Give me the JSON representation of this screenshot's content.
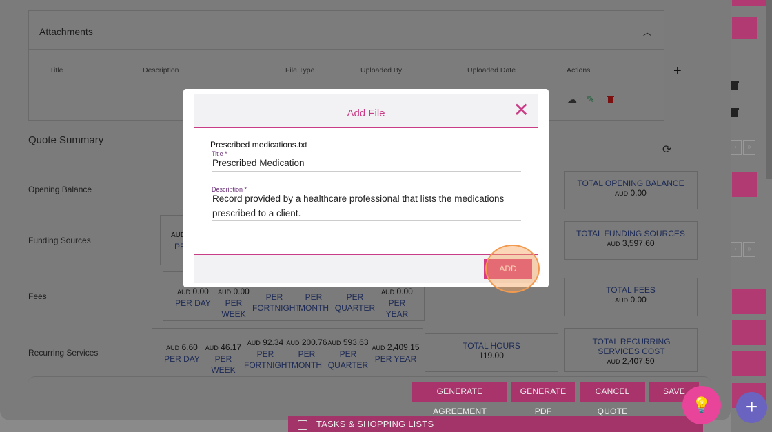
{
  "attachments": {
    "title": "Attachments",
    "headers": [
      "Title",
      "Description",
      "File Type",
      "Uploaded By",
      "Uploaded Date",
      "Actions"
    ]
  },
  "quote_summary": {
    "title": "Quote Summary",
    "rows": {
      "opening_balance": "Opening Balance",
      "funding_sources": "Funding Sources",
      "fees": "Fees",
      "recurring_services": "Recurring Services"
    },
    "funding_partial": {
      "cur": "AUD",
      "per": "PE"
    },
    "fees_cells": [
      {
        "cur": "AUD",
        "amount": "0.00",
        "period": "PER DAY"
      },
      {
        "cur": "AUD",
        "amount": "0.00",
        "period": "PER WEEK"
      },
      {
        "period": "PER FORTNIGHT"
      },
      {
        "period": "PER MONTH"
      },
      {
        "period": "PER QUARTER"
      },
      {
        "cur": "AUD",
        "amount": "0.00",
        "period": "PER YEAR"
      }
    ],
    "recurring_cells": [
      {
        "cur": "AUD",
        "amount": "6.60",
        "period": "PER DAY"
      },
      {
        "cur": "AUD",
        "amount": "46.17",
        "period": "PER WEEK"
      },
      {
        "cur": "AUD",
        "amount": "92.34",
        "period": "PER FORTNIGHT"
      },
      {
        "cur": "AUD",
        "amount": "200.76",
        "period": "PER MONTH"
      },
      {
        "cur": "AUD",
        "amount": "593.63",
        "period": "PER QUARTER"
      },
      {
        "cur": "AUD",
        "amount": "2,409.15",
        "period": "PER YEAR"
      }
    ],
    "totals": {
      "opening": {
        "label": "TOTAL OPENING BALANCE",
        "cur": "AUD",
        "value": "0.00"
      },
      "funding": {
        "label": "TOTAL FUNDING SOURCES",
        "cur": "AUD",
        "value": "3,597.60"
      },
      "fees": {
        "label": "TOTAL FEES",
        "cur": "AUD",
        "value": "0.00"
      },
      "recurring": {
        "label": "TOTAL RECURRING SERVICES COST",
        "cur": "AUD",
        "value": "2,407.50"
      },
      "hours": {
        "label": "TOTAL HOURS",
        "value": "119.00"
      }
    }
  },
  "actions": {
    "generate_agreement": "GENERATE AGREEMENT",
    "generate_pdf": "GENERATE PDF",
    "cancel_quote": "CANCEL QUOTE",
    "save": "SAVE"
  },
  "bottom_bar": {
    "label": "TASKS & SHOPPING LISTS"
  },
  "modal": {
    "title": "Add File",
    "file_name": "Prescribed medications.txt",
    "title_label": "Title *",
    "title_value": "Prescribed Medication",
    "description_label": "Description *",
    "description_value_line1": "Record provided by a healthcare professional that lists the medications",
    "description_value_line2": "prescribed to a client.",
    "add_button": "ADD"
  },
  "icons": {
    "close": "close-icon",
    "upload": "cloud-upload-icon",
    "edit": "pencil-icon",
    "delete": "trash-icon",
    "refresh": "refresh-icon",
    "add": "plus-icon",
    "bulb": "lightbulb-icon"
  },
  "colors": {
    "accent": "#d63b83",
    "accent_text": "#c93c86",
    "fab_purple": "#6a63c0"
  }
}
